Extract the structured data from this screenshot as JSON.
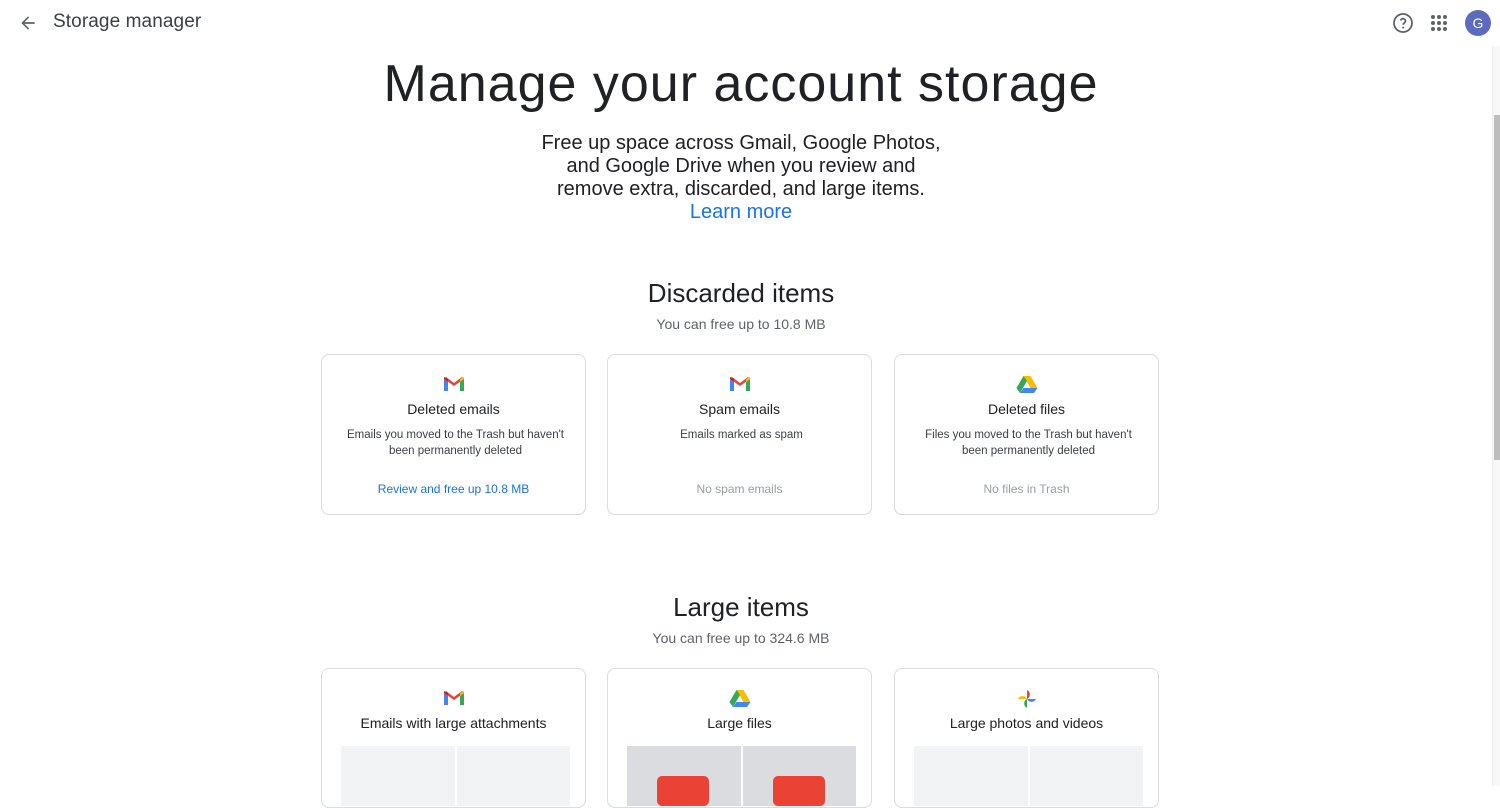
{
  "header": {
    "title": "Storage manager",
    "back_icon": "arrow-back-icon",
    "help_icon": "help-circle-icon",
    "apps_icon": "apps-grid-icon",
    "avatar_letter": "G",
    "avatar_color": "#5c6bc0"
  },
  "hero": {
    "title": "Manage your account storage",
    "subtitle": "Free up space across Gmail, Google Photos, and Google Drive when you review and remove extra, discarded, and large items.",
    "learn_more": "Learn more",
    "link_color": "#1a73e8"
  },
  "discarded": {
    "title": "Discarded items",
    "subtitle": "You can free up to 10.8 MB",
    "cards": [
      {
        "icon": "gmail-icon",
        "title": "Deleted emails",
        "description": "Emails you moved to the Trash but haven't been permanently deleted",
        "action": "Review and free up 10.8 MB"
      },
      {
        "icon": "gmail-icon",
        "title": "Spam emails",
        "description": "Emails marked as spam",
        "action": "No spam emails"
      },
      {
        "icon": "google-drive-icon",
        "title": "Deleted files",
        "description": "Files you moved to the Trash but haven't been permanently deleted",
        "action": "No files in Trash"
      }
    ]
  },
  "large": {
    "title": "Large items",
    "subtitle": "You can free up to 324.6 MB",
    "cards": [
      {
        "icon": "gmail-icon",
        "title": "Emails with large attachments"
      },
      {
        "icon": "google-drive-icon",
        "title": "Large files"
      },
      {
        "icon": "google-photos-icon",
        "title": "Large photos and videos"
      }
    ]
  }
}
